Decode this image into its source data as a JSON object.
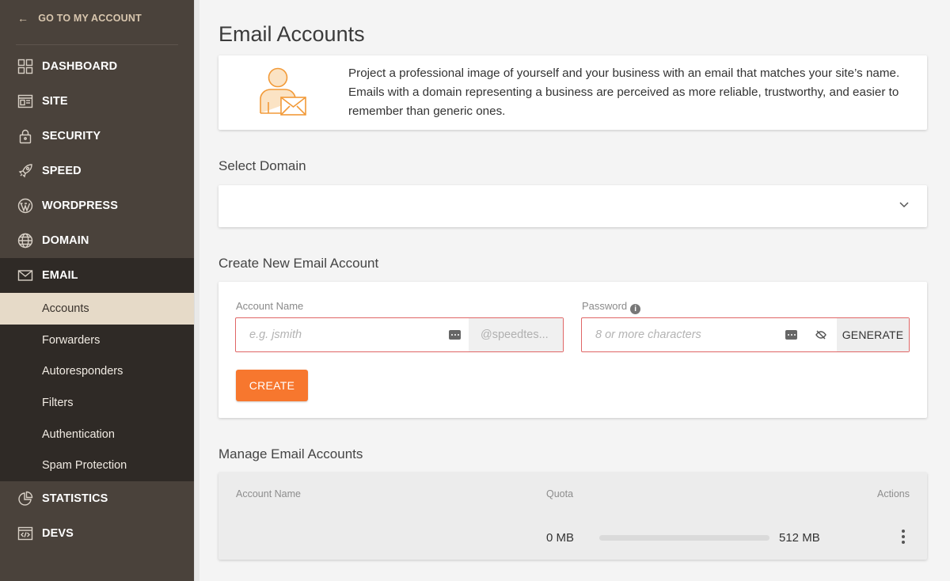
{
  "sidebar": {
    "back_link": "GO TO MY ACCOUNT",
    "items": [
      {
        "label": "DASHBOARD",
        "icon": "dashboard-icon"
      },
      {
        "label": "SITE",
        "icon": "site-icon"
      },
      {
        "label": "SECURITY",
        "icon": "lock-icon"
      },
      {
        "label": "SPEED",
        "icon": "rocket-icon"
      },
      {
        "label": "WORDPRESS",
        "icon": "wordpress-icon"
      },
      {
        "label": "DOMAIN",
        "icon": "globe-icon"
      },
      {
        "label": "EMAIL",
        "icon": "envelope-icon"
      },
      {
        "label": "STATISTICS",
        "icon": "pie-chart-icon"
      },
      {
        "label": "DEVS",
        "icon": "code-icon"
      }
    ],
    "email_subitems": [
      "Accounts",
      "Forwarders",
      "Autoresponders",
      "Filters",
      "Authentication",
      "Spam Protection"
    ],
    "active_subitem": "Accounts"
  },
  "page": {
    "title": "Email Accounts",
    "intro": "Project a professional image of yourself and your business with an email that matches your site’s name. Emails with a domain representing a business are perceived as more reliable, trustworthy, and easier to remember than generic ones."
  },
  "select_domain": {
    "title": "Select Domain",
    "value": ""
  },
  "create": {
    "title": "Create New Email Account",
    "account_label": "Account Name",
    "account_placeholder": "e.g. jsmith",
    "domain_suffix": "@speedtes...",
    "password_label": "Password",
    "password_placeholder": "8 or more characters",
    "generate_label": "GENERATE",
    "create_label": "CREATE"
  },
  "manage": {
    "title": "Manage Email Accounts",
    "columns": [
      "Account Name",
      "Quota",
      "Actions"
    ],
    "rows": [
      {
        "account": "",
        "used": "0 MB",
        "total": "512 MB",
        "usage_fraction": 0
      }
    ]
  },
  "colors": {
    "accent": "#f7772e",
    "sidebar_bg": "#4a423b",
    "sidebar_active": "#e6dac8",
    "error_border": "#e06666"
  }
}
